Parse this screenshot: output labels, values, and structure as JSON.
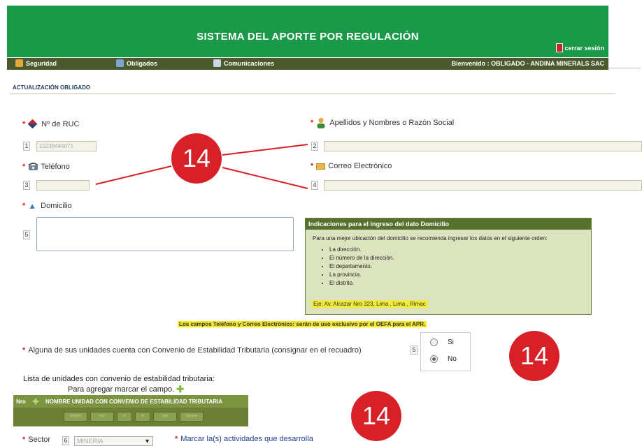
{
  "header": {
    "title": "SISTEMA DEL APORTE POR REGULACIÓN",
    "logout_label": "cerrar sesión"
  },
  "nav": {
    "items": [
      "Seguridad",
      "Obligados",
      "Comunicaciones"
    ],
    "welcome": "Bienvenido : OBLIGADO - ANDINA MINERALS SAC"
  },
  "page": {
    "section_title": "ACTUALIZACIÓN OBLIGADO"
  },
  "form": {
    "ruc": {
      "required": "*",
      "label": "Nº de RUC",
      "tab": "1",
      "value": "10239444071"
    },
    "name": {
      "required": "*",
      "label": "Apellidos y Nombres o Razón Social",
      "tab": "2",
      "value": ""
    },
    "phone": {
      "required": "*",
      "label": "Teléfono",
      "tab": "3",
      "value": ""
    },
    "email": {
      "required": "*",
      "label": "Correo Electrónico",
      "tab": "4",
      "value": ""
    },
    "address": {
      "required": "*",
      "label": "Domicilio",
      "tab": "5",
      "value": ""
    }
  },
  "info_box": {
    "title": "Indicaciones para el ingreso del dato Domicilio",
    "intro": "Para una mejor ubicación del domicilio se recomienda ingresar los datos en el siguiente orden:",
    "items": [
      "La dirección.",
      "El número de la dirección.",
      "El departamento.",
      "La provincia.",
      "El distrito."
    ],
    "example": "Eje: Av. Alcazar Nro 323, Lima , Lima , Rimac"
  },
  "notice": "Los campos Teléfono y Correo Electrónico: serán de uso exclusivo por el OEFA para el APR.",
  "stability": {
    "required": "*",
    "question": "Alguna de sus unidades cuenta con Convenio de Estabilidad Tributaria (consignar en el recuadro)",
    "tab": "5",
    "options": [
      "Si",
      "No"
    ],
    "selected": "No"
  },
  "units": {
    "list_label": "Lista de unidades con convenio de estabilidad tributaria:",
    "add_hint": "Para agregar marcar el campo.",
    "columns": [
      "Nro",
      "",
      "NOMBRE UNIDAD CON CONVENIO DE ESTABILIDAD TRIBUTARIA"
    ],
    "pager": [
      "<<<<",
      "<<",
      "<",
      ">",
      ">>",
      ">>>>"
    ]
  },
  "sector": {
    "required": "*",
    "label": "Sector",
    "tab": "6",
    "value": "MINERIA",
    "activities_label": "Marcar la(s) actividades que desarrolla"
  },
  "markers": [
    "14",
    "14",
    "14"
  ],
  "colors": {
    "header_green": "#1a9a49",
    "nav_olive": "#4b5a2c",
    "marker_red": "#d72027"
  }
}
